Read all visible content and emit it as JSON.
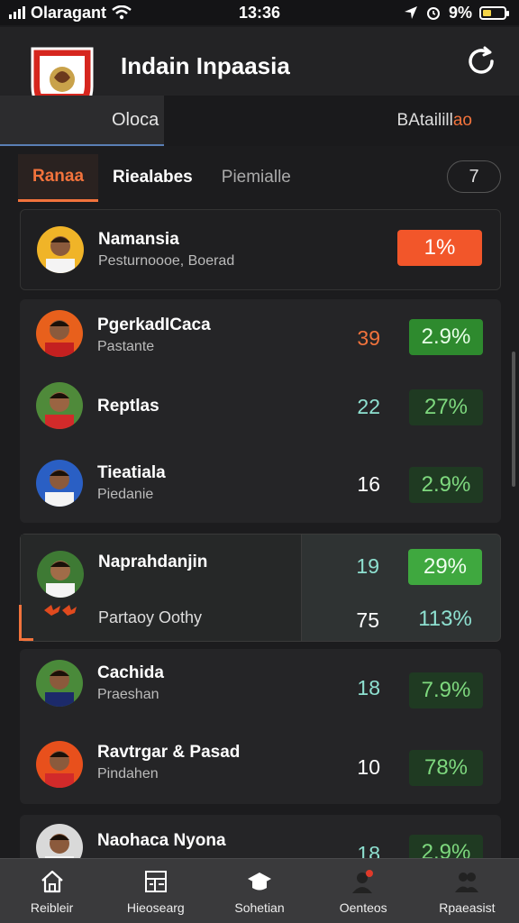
{
  "status_bar": {
    "carrier": "Olaragant",
    "time": "13:36",
    "battery": "9%"
  },
  "header": {
    "title": "Indain Inpaasia",
    "subnav_left": "Oloca",
    "subnav_right_prefix": "B ",
    "subnav_right_main": "Atailill",
    "subnav_right_accent": "ao"
  },
  "tabs": [
    {
      "label": "Ranaa"
    },
    {
      "label": "Riealabes"
    },
    {
      "label": "Piemialle"
    }
  ],
  "tab_counter": "7",
  "featured": {
    "name": "Namansia",
    "sub": "Pesturnoooe, Boerad",
    "pct": "1%"
  },
  "players": [
    {
      "name": "PgerkadICaca",
      "sub": "Pastante",
      "num": "39",
      "pct": "2.9%",
      "num_color": "#f2733c",
      "pct_bright": true
    },
    {
      "name": "Reptlas",
      "sub": "",
      "num": "22",
      "pct": "27%",
      "num_color": "#8ee0d0",
      "pct_bright": false
    },
    {
      "name": "Tieatiala",
      "sub": "Piedanie",
      "num": "16",
      "pct": "2.9%",
      "num_color": "#ffffff",
      "pct_bright": false
    }
  ],
  "highlighted": {
    "name": "Naprahdanjin",
    "sub": "Partaoy Oothy",
    "num": "19",
    "num2": "75",
    "pct": "29%",
    "pct2": "113%"
  },
  "players2": [
    {
      "name": "Cachida",
      "sub": "Praeshan",
      "num": "18",
      "pct": "7.9%"
    },
    {
      "name": "Ravtrgar & Pasad",
      "sub": "Pindahen",
      "num": "10",
      "pct": "78%"
    },
    {
      "name": "Naohaca Nyona",
      "sub": "",
      "num": "18",
      "pct": "2.9%"
    }
  ],
  "bottom_nav": [
    {
      "label": "Reibleir",
      "icon": "home-icon"
    },
    {
      "label": "Hieosearg",
      "icon": "stats-icon"
    },
    {
      "label": "Sohetian",
      "icon": "graduation-cap-icon"
    },
    {
      "label": "Oenteos",
      "icon": "coach-icon"
    },
    {
      "label": "Rpaeasist",
      "icon": "team-icon"
    }
  ],
  "colors": {
    "accent": "#f2733c",
    "green": "#3fbf3f",
    "background": "#1c1c1e"
  }
}
